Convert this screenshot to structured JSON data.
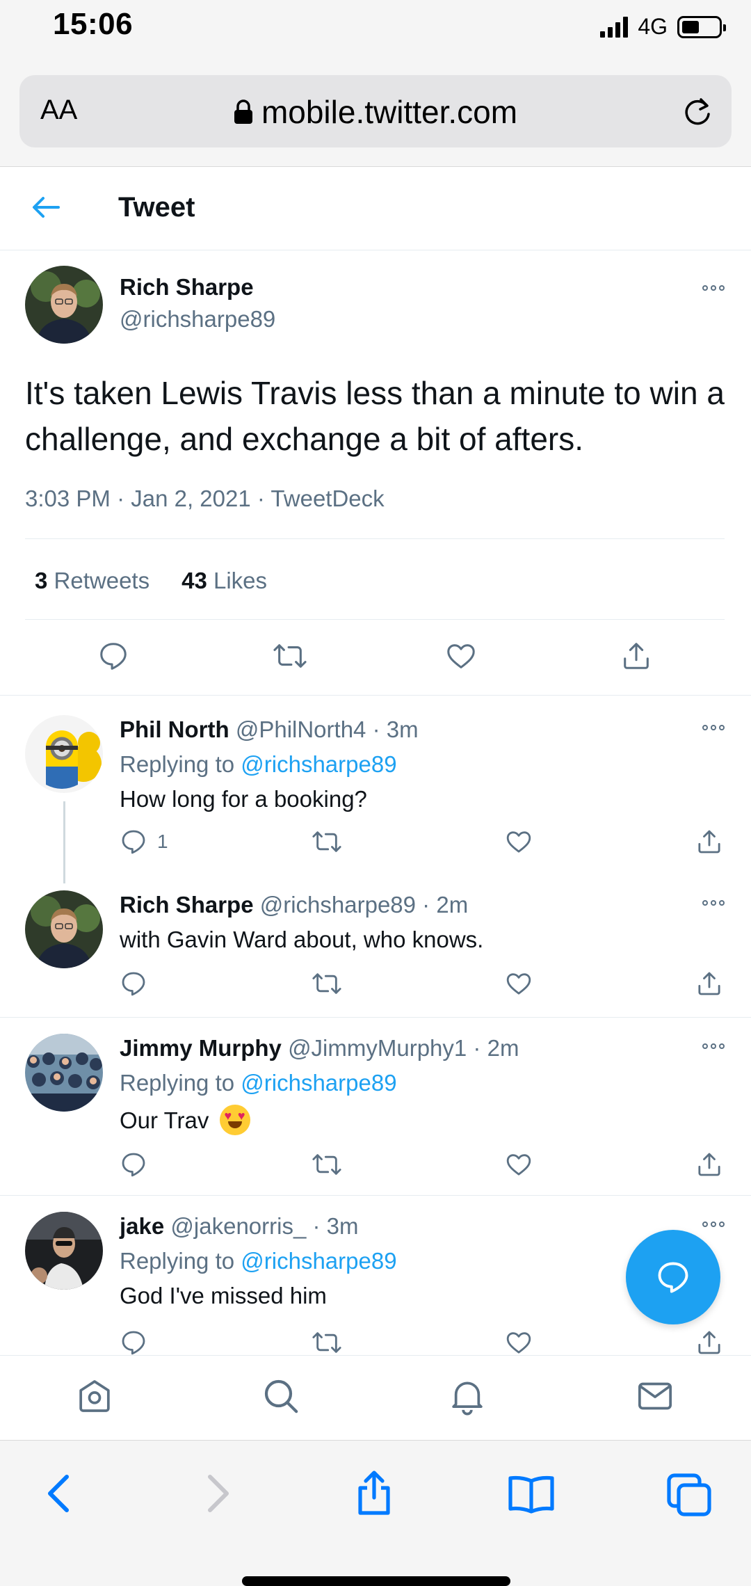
{
  "status_bar": {
    "time": "15:06",
    "network": "4G"
  },
  "browser": {
    "text_size": "AA",
    "url": "mobile.twitter.com"
  },
  "header": {
    "title": "Tweet"
  },
  "tweet": {
    "name": "Rich Sharpe",
    "handle": "@richsharpe89",
    "text": "It's taken Lewis Travis less than a minute to win a challenge, and exchange a bit of afters.",
    "meta": "3:03 PM · Jan 2, 2021 · TweetDeck",
    "retweets_count": "3",
    "retweets_label": "Retweets",
    "likes_count": "43",
    "likes_label": "Likes"
  },
  "replies": [
    {
      "name": "Phil North",
      "handle": "@PhilNorth4 · 3m",
      "replying_prefix": "Replying to ",
      "replying_to": "@richsharpe89",
      "text": "How long for a booking?",
      "reply_count": "1"
    },
    {
      "name": "Rich Sharpe",
      "handle": "@richsharpe89 · 2m",
      "text": "with Gavin Ward about, who knows."
    },
    {
      "name": "Jimmy Murphy",
      "handle": "@JimmyMurphy1 · 2m",
      "replying_prefix": "Replying to ",
      "replying_to": "@richsharpe89",
      "text": "Our Trav"
    },
    {
      "name": "jake",
      "handle": "@jakenorris_ · 3m",
      "replying_prefix": "Replying to ",
      "replying_to": "@richsharpe89",
      "text": "God I've missed him"
    }
  ],
  "colors": {
    "accent": "#1da1f2",
    "secondary_text": "#5b7083",
    "divider": "#e6ecf0",
    "ios_blue": "#007aff"
  },
  "icons": {
    "tw_nav": [
      "home-icon",
      "search-icon",
      "notifications-icon",
      "messages-icon"
    ],
    "safari": [
      "back-icon",
      "forward-icon",
      "share-icon",
      "bookmarks-icon",
      "tabs-icon"
    ]
  }
}
